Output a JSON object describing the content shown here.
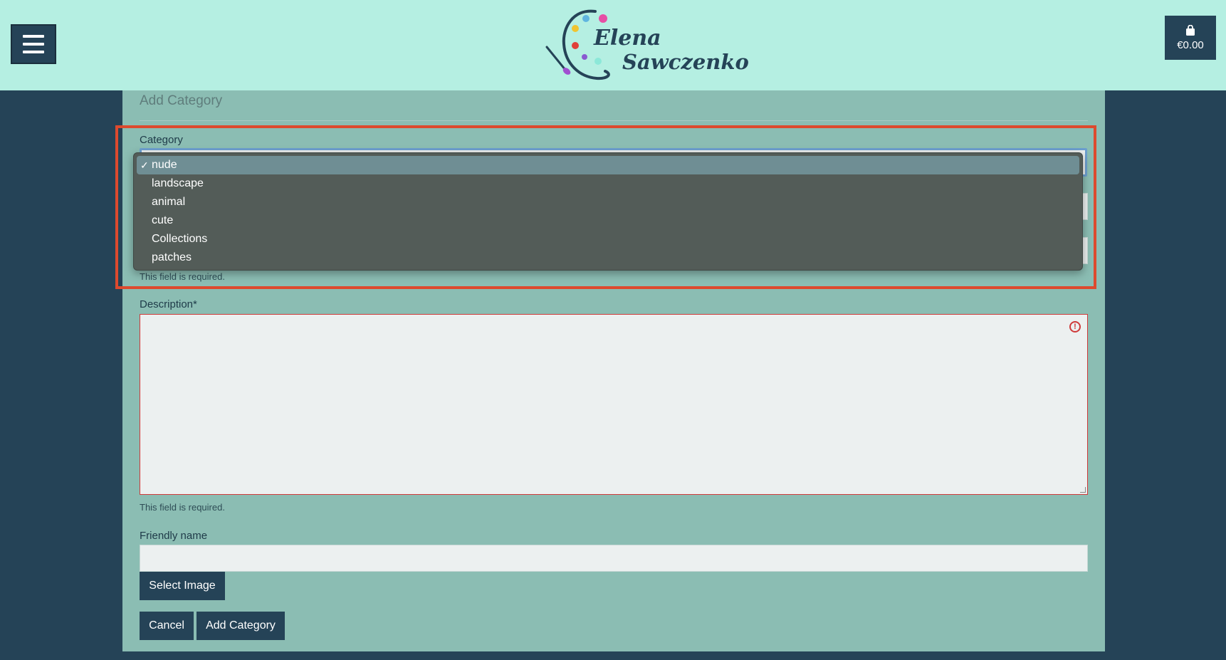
{
  "header": {
    "logo_first": "Elena",
    "logo_last": "Sawczenko",
    "cart_amount": "€0.00"
  },
  "form": {
    "title": "Add Category",
    "category_label": "Category",
    "category_options": [
      "nude",
      "landscape",
      "animal",
      "cute",
      "Collections",
      "patches"
    ],
    "category_selected": "nude",
    "required_help": "This field is required.",
    "description_label": "Description*",
    "friendly_name_label": "Friendly name",
    "select_image_label": "Select Image",
    "cancel_label": "Cancel",
    "submit_label": "Add Category"
  },
  "colors": {
    "header_bg": "#b5efe2",
    "page_bg": "#254357",
    "panel_bg": "#8bbdb3",
    "button_bg": "#254357",
    "error": "#cf3a3a",
    "highlight": "#dd4a2e"
  },
  "icons": {
    "menu": "hamburger-icon",
    "cart": "shopping-bag-icon",
    "error": "exclamation-circle-icon",
    "check": "checkmark-icon"
  }
}
